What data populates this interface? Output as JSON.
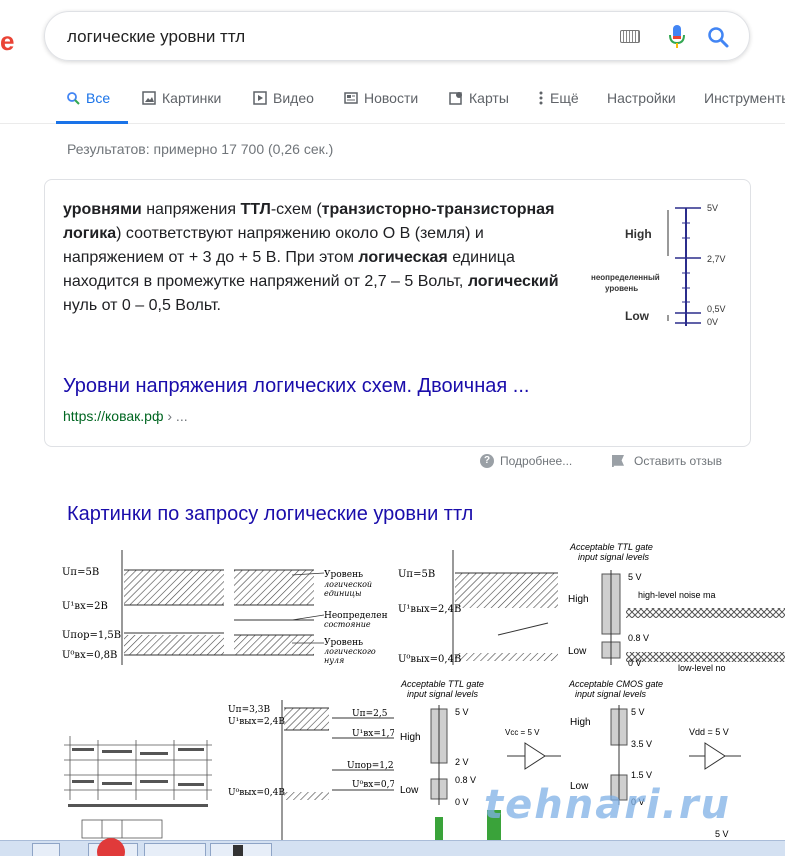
{
  "search": {
    "query": "логические уровни ттл"
  },
  "tabs": [
    {
      "label": "Все",
      "icon": "search-icon"
    },
    {
      "label": "Картинки",
      "icon": "image-icon"
    },
    {
      "label": "Видео",
      "icon": "video-icon"
    },
    {
      "label": "Новости",
      "icon": "news-icon"
    },
    {
      "label": "Карты",
      "icon": "map-icon"
    },
    {
      "label": "Ещё",
      "icon": "more-icon"
    },
    {
      "label": "Настройки",
      "icon": ""
    },
    {
      "label": "Инструменты",
      "icon": ""
    }
  ],
  "stats": "Результатов: примерно 17 700 (0,26 сек.)",
  "snippet": {
    "parts": [
      {
        "t": "уровнями",
        "b": true
      },
      {
        "t": " напряжения ",
        "b": false
      },
      {
        "t": "ТТЛ",
        "b": true
      },
      {
        "t": "-схем (",
        "b": false
      },
      {
        "t": "транзисторно-транзисторная логика",
        "b": true
      },
      {
        "t": ") соответствуют напряжению около О В (земля) и напряжением от + 3 до + 5 В. При этом ",
        "b": false
      },
      {
        "t": "логическая",
        "b": true
      },
      {
        "t": " единица находится в промежутке напряжений от 2,7 – 5 Вольт, ",
        "b": false
      },
      {
        "t": "логический",
        "b": true
      },
      {
        "t": " нуль от 0 – 0,5 Вольт.",
        "b": false
      }
    ],
    "figure": {
      "high": "High",
      "low": "Low",
      "undefined_line1": "неопределенный",
      "undefined_line2": "уровень",
      "v5": "5V",
      "v27": "2,7V",
      "v05": "0,5V",
      "v0": "0V"
    },
    "title": "Уровни напряжения логических схем. Двоичная ...",
    "url": "https://ковак.рф",
    "url_suffix": " › ..."
  },
  "feedback": {
    "more": "Подробнее...",
    "report": "Оставить отзыв"
  },
  "images": {
    "heading": "Картинки по запросу логические уровни ттл",
    "thumb1": {
      "un": "Uп=5В",
      "u1": "U¹вх=2В",
      "upor": "Uпор=1,5В",
      "u0": "U⁰вх=0,8В",
      "l1a": "Уровень",
      "l1b": "логической",
      "l1c": "единицы",
      "l2a": "Неопределен",
      "l2b": "состояние",
      "l3a": "Уровень",
      "l3b": "логического",
      "l3c": "нуля"
    },
    "thumb2": {
      "un": "Uп=5В",
      "u1": "U¹вых=2,4В",
      "u0": "U⁰вых=0,4В"
    },
    "thumb3": {
      "t1": "Acceptable TTL gate",
      "t2": "input signal levels",
      "high": "High",
      "low": "Low",
      "v5": "5 V",
      "v08": "0.8 V",
      "v0": "0 V",
      "noise_hi": "high-level noise ma",
      "noise_lo": "low-level no"
    },
    "thumb4": {
      "u1": "Uп=3,3В",
      "u2": "U¹вых=2,4В",
      "u3": "U⁰вых=0,4В",
      "r1": "Uп=2,5",
      "r2": "U¹вх=1,7",
      "r3": "Uпор=1,2",
      "r4": "U⁰вх=0,7"
    },
    "thumb5": {
      "t1": "Acceptable TTL gate",
      "t2": "input signal levels",
      "high": "High",
      "low": "Low",
      "v5": "5 V",
      "v2": "2 V",
      "v08": "0.8 V",
      "v0": "0 V",
      "vcc": "Vcc = 5 V"
    },
    "thumb6": {
      "t1": "Acceptable CMOS gate",
      "t2": "input signal levels",
      "high": "High",
      "low": "Low",
      "v5": "5 V",
      "v35": "3.5 V",
      "v15": "1.5 V",
      "v0": "0 V",
      "vdd": "Vdd = 5 V"
    },
    "watermark": "tehnari.ru"
  }
}
